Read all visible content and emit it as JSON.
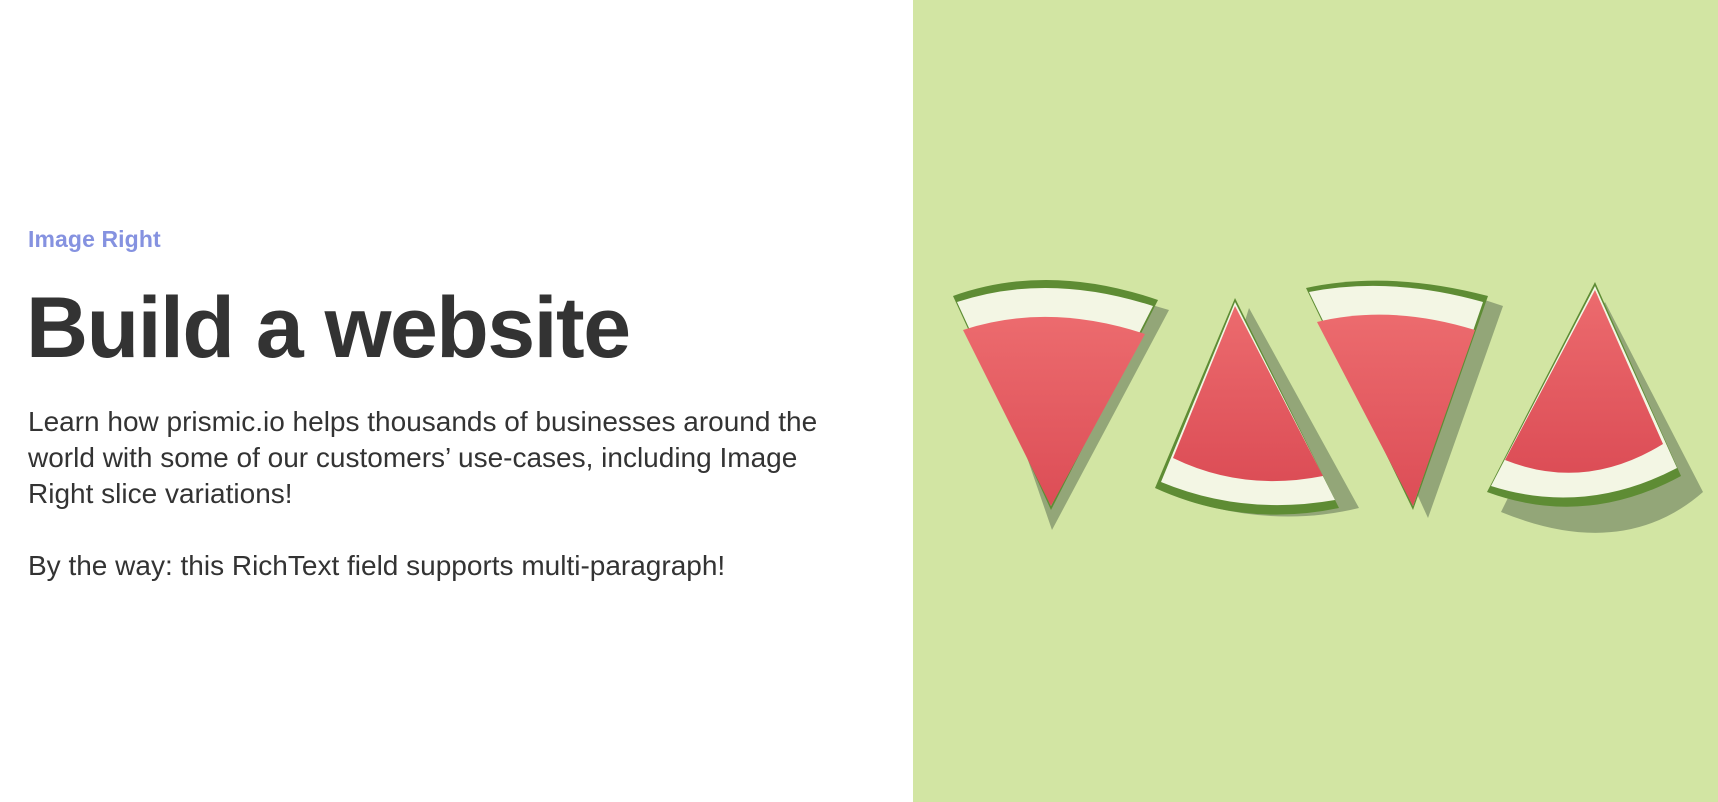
{
  "slice": {
    "eyebrow": "Image Right",
    "title": "Build a website",
    "paragraphs": [
      "Learn how prismic.io helps thousands of businesses around the world with some of our customers’ use-cases, including Image Right slice variations!",
      "By the way: this RichText field supports multi-paragraph!"
    ]
  },
  "image": {
    "icon": "watermelon-slices-image",
    "background_color": "#d2e5a3",
    "flesh_color": "#e35a5e",
    "rind_color": "#6f9a3c"
  }
}
